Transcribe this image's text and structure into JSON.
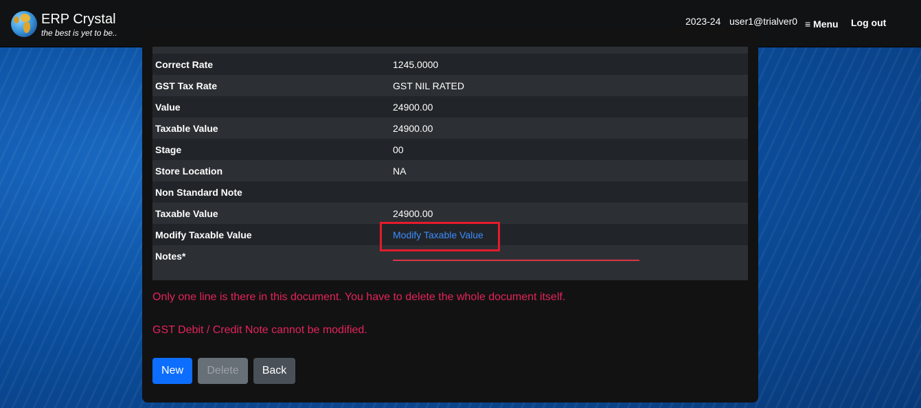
{
  "header": {
    "app_title": "ERP Crystal",
    "tagline": "the best is yet to be..",
    "fiscal_year": "2023-24",
    "user": "user1@trialver0",
    "menu_label": "≡ Menu",
    "logout_label": "Log out"
  },
  "details": {
    "rows": [
      {
        "label": "Correct Rate",
        "value": "1245.0000"
      },
      {
        "label": "GST Tax Rate",
        "value": "GST NIL RATED"
      },
      {
        "label": "Value",
        "value": "24900.00"
      },
      {
        "label": "Taxable Value",
        "value": "24900.00"
      },
      {
        "label": "Stage",
        "value": "00"
      },
      {
        "label": "Store Location",
        "value": "NA"
      },
      {
        "label": "Non Standard Note",
        "value": ""
      },
      {
        "label": "Taxable Value",
        "value": "24900.00"
      },
      {
        "label": "Modify Taxable Value",
        "link": "Modify Taxable Value"
      },
      {
        "label": "Notes*",
        "value": ""
      }
    ]
  },
  "messages": {
    "one_line": "Only one line is there in this document. You have to delete the whole document itself.",
    "gst_note": "GST Debit / Credit Note cannot be modified."
  },
  "buttons": {
    "new": "New",
    "delete": "Delete",
    "back": "Back"
  },
  "colors": {
    "link": "#3d8bfd",
    "error_text": "#e4245a",
    "highlight_border": "#e51b2b",
    "primary_button": "#0d6efd"
  }
}
